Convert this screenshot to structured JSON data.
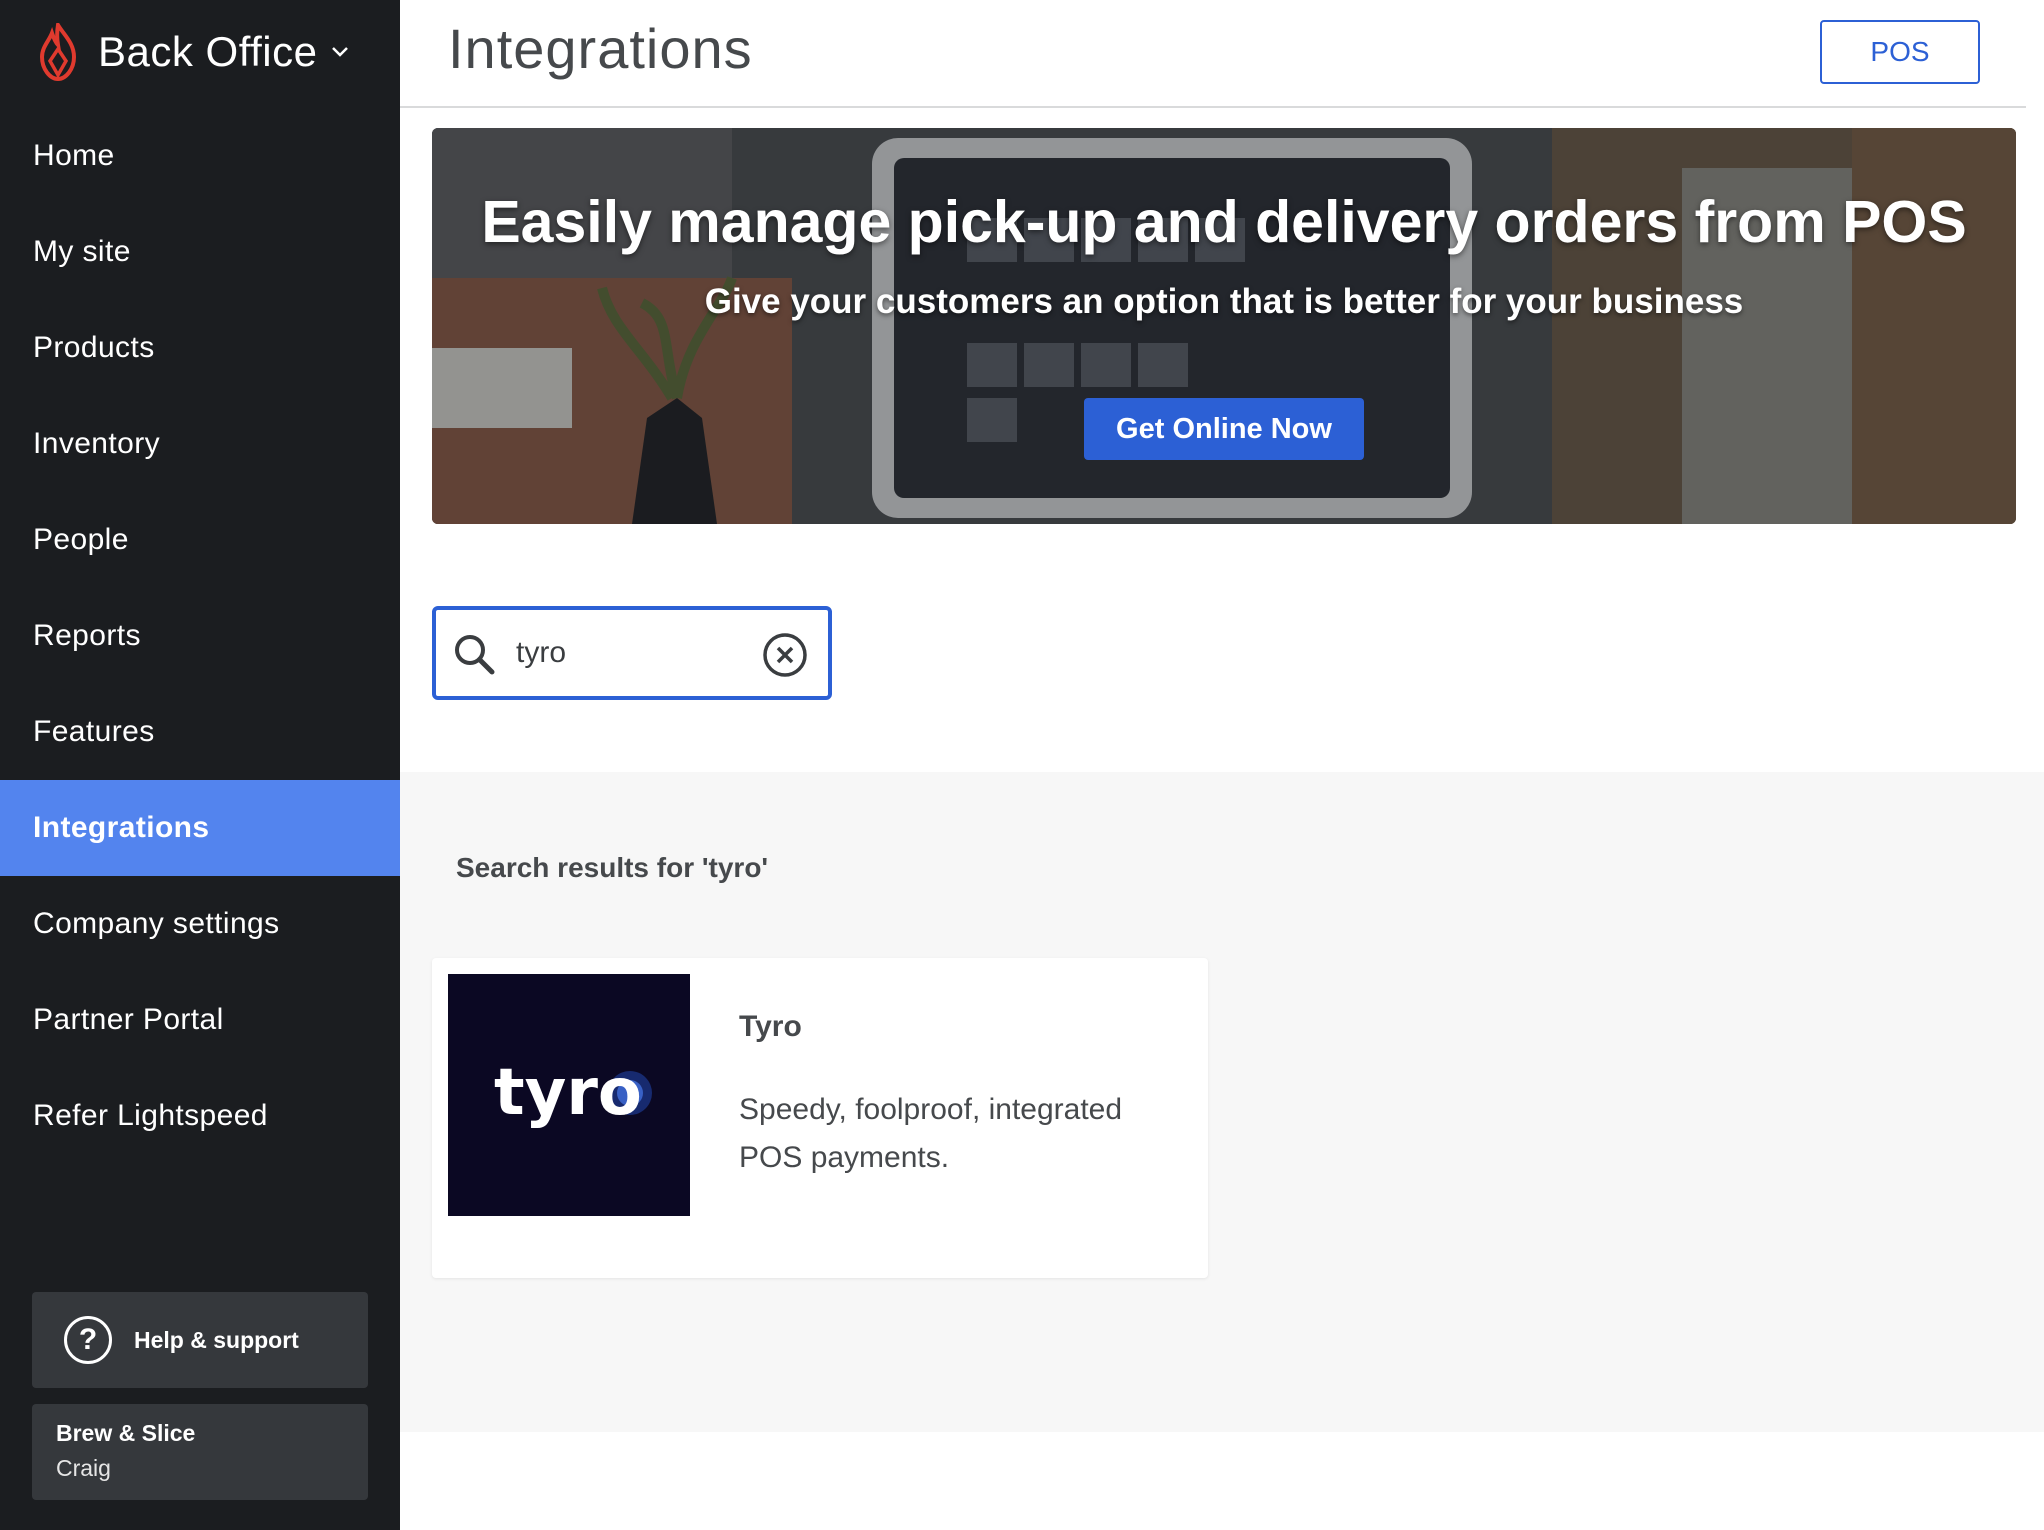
{
  "sidebar": {
    "brand": "Back Office",
    "items": [
      {
        "label": "Home",
        "active": false
      },
      {
        "label": "My site",
        "active": false
      },
      {
        "label": "Products",
        "active": false
      },
      {
        "label": "Inventory",
        "active": false
      },
      {
        "label": "People",
        "active": false
      },
      {
        "label": "Reports",
        "active": false
      },
      {
        "label": "Features",
        "active": false
      },
      {
        "label": "Integrations",
        "active": true
      },
      {
        "label": "Company settings",
        "active": false
      },
      {
        "label": "Partner Portal",
        "active": false
      },
      {
        "label": "Refer Lightspeed",
        "active": false
      }
    ],
    "help_label": "Help & support",
    "account": {
      "business": "Brew & Slice",
      "user": "Craig"
    }
  },
  "header": {
    "title": "Integrations",
    "pos_button": "POS"
  },
  "banner": {
    "headline": "Easily manage pick-up and delivery orders from POS",
    "subtitle": "Give your customers an option that is better for your business",
    "cta": "Get Online Now"
  },
  "search": {
    "value": "tyro"
  },
  "results": {
    "heading": "Search results for 'tyro'",
    "items": [
      {
        "title": "Tyro",
        "description": "Speedy, foolproof, integrated POS payments.",
        "logo_text": "tyro"
      }
    ]
  },
  "colors": {
    "sidebar_bg": "#1b1d20",
    "active_item": "#5384ee",
    "accent": "#2c60d5",
    "brand_red": "#e03a2e",
    "results_bg": "#f7f7f7",
    "tyro_tile": "#0b0823"
  },
  "icons": [
    "lightspeed-flame-icon",
    "chevron-down-icon",
    "help-circle-icon",
    "search-icon",
    "clear-circle-x-icon"
  ]
}
